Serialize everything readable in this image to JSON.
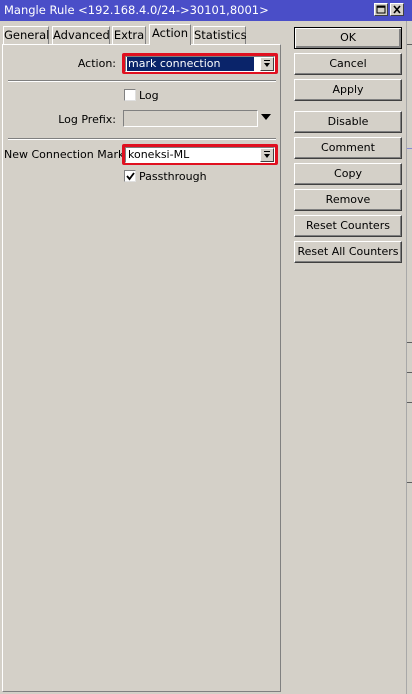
{
  "window": {
    "title": "Mangle Rule <192.168.4.0/24->30101,8001>"
  },
  "tabs": [
    {
      "label": "General"
    },
    {
      "label": "Advanced"
    },
    {
      "label": "Extra"
    },
    {
      "label": "Action",
      "active": true
    },
    {
      "label": "Statistics"
    }
  ],
  "form": {
    "action_label": "Action:",
    "action_value": "mark connection",
    "log_label": "Log",
    "log_checked": false,
    "log_prefix_label": "Log Prefix:",
    "log_prefix_value": "",
    "new_connection_mark_label": "New Connection Mark:",
    "new_connection_mark_value": "koneksi-ML",
    "passthrough_label": "Passthrough",
    "passthrough_checked": true
  },
  "buttons": {
    "ok": "OK",
    "cancel": "Cancel",
    "apply": "Apply",
    "disable": "Disable",
    "comment": "Comment",
    "copy": "Copy",
    "remove": "Remove",
    "reset_counters": "Reset Counters",
    "reset_all_counters": "Reset All Counters"
  },
  "colors": {
    "titlebar": "#4a4ec8",
    "highlight": "#e01020",
    "selection": "#0a246a",
    "face": "#d4d0c8"
  },
  "icons": {
    "maximize": "maximize-icon",
    "close": "close-icon",
    "dropdown": "down-arrow-icon",
    "check": "checkmark-icon"
  }
}
